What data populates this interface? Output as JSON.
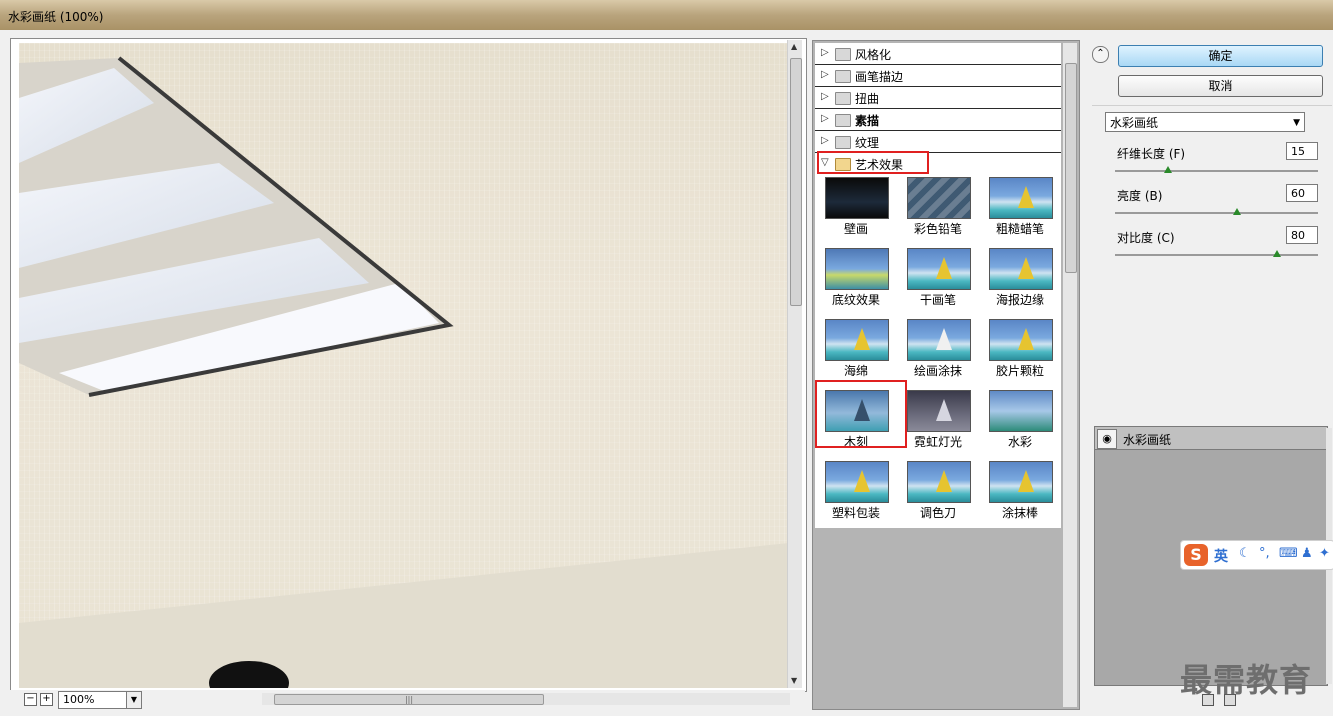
{
  "window": {
    "title": "水彩画纸 (100%)"
  },
  "preview": {
    "zoom": "100%"
  },
  "categories": [
    {
      "label": "风格化",
      "expanded": false,
      "bold": false
    },
    {
      "label": "画笔描边",
      "expanded": false,
      "bold": false
    },
    {
      "label": "扭曲",
      "expanded": false,
      "bold": false
    },
    {
      "label": "素描",
      "expanded": false,
      "bold": true
    },
    {
      "label": "纹理",
      "expanded": false,
      "bold": false
    },
    {
      "label": "艺术效果",
      "expanded": true,
      "bold": false
    }
  ],
  "filters": [
    {
      "label": "壁画"
    },
    {
      "label": "彩色铅笔"
    },
    {
      "label": "粗糙蜡笔"
    },
    {
      "label": "底纹效果"
    },
    {
      "label": "干画笔"
    },
    {
      "label": "海报边缘"
    },
    {
      "label": "海绵"
    },
    {
      "label": "绘画涂抹"
    },
    {
      "label": "胶片颗粒"
    },
    {
      "label": "木刻"
    },
    {
      "label": "霓虹灯光"
    },
    {
      "label": "水彩"
    },
    {
      "label": "塑料包装"
    },
    {
      "label": "调色刀"
    },
    {
      "label": "涂抹棒"
    }
  ],
  "buttons": {
    "ok": "确定",
    "cancel": "取消"
  },
  "filter_select": {
    "value": "水彩画纸"
  },
  "params": [
    {
      "label": "纤维长度 (F)",
      "value": "15",
      "slider": 0.25
    },
    {
      "label": "亮度 (B)",
      "value": "60",
      "slider": 0.6
    },
    {
      "label": "对比度 (C)",
      "value": "80",
      "slider": 0.8
    }
  ],
  "layers": [
    {
      "label": "水彩画纸"
    }
  ],
  "ime": {
    "lang": "英"
  },
  "watermark": "最需教育",
  "colors": {
    "highlight": "#e02020",
    "primary_button": "#a9d8f5"
  }
}
